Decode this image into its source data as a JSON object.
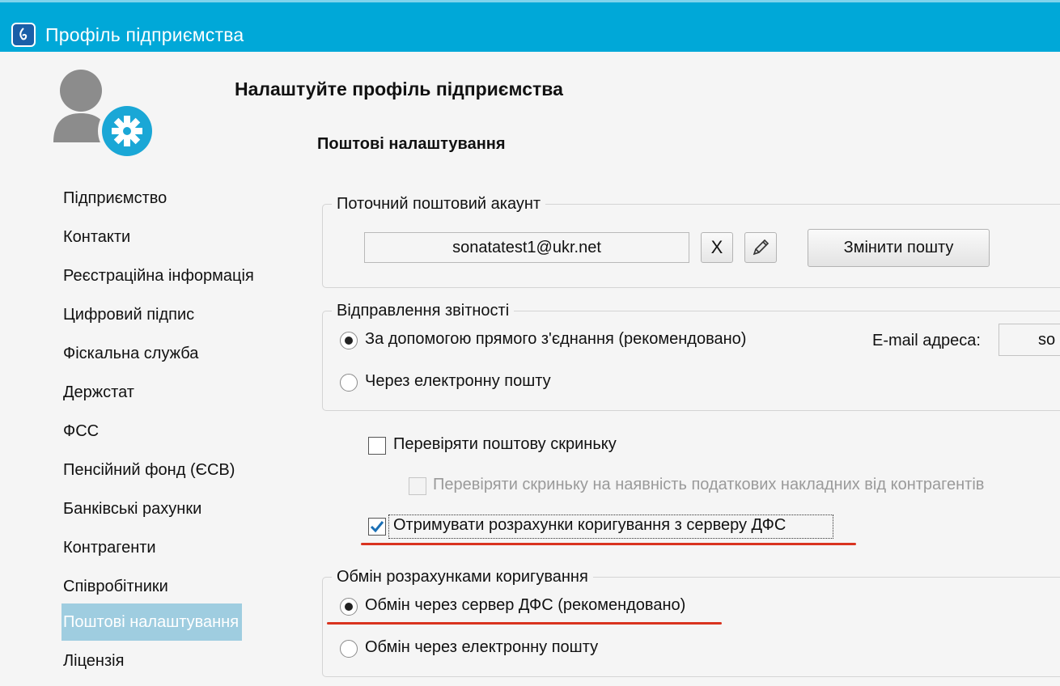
{
  "window": {
    "title": "Профіль підприємства"
  },
  "header": {
    "heading": "Налаштуйте профіль підприємства",
    "section_title": "Поштові налаштування"
  },
  "sidebar": {
    "items": [
      {
        "label": "Підприємство"
      },
      {
        "label": "Контакти"
      },
      {
        "label": "Реєстраційна інформація"
      },
      {
        "label": "Цифровий підпис"
      },
      {
        "label": "Фіскальна служба"
      },
      {
        "label": "Держстат"
      },
      {
        "label": "ФСС"
      },
      {
        "label": "Пенсійний фонд (ЄСВ)"
      },
      {
        "label": "Банківські рахунки"
      },
      {
        "label": "Контрагенти"
      },
      {
        "label": "Співробітники"
      },
      {
        "label": "Поштові налаштування",
        "active": true
      },
      {
        "label": "Ліцензія"
      }
    ]
  },
  "mail_account": {
    "legend": "Поточний поштовий акаунт",
    "email_value": "sonatatest1@ukr.net",
    "clear_label": "X",
    "change_button_label": "Змінити пошту"
  },
  "reporting": {
    "legend": "Відправлення звітності",
    "option_direct": "За допомогою прямого з'єднання (рекомендовано)",
    "option_email": "Через електронну пошту",
    "email_address_label": "E-mail адреса:",
    "email_address_value": "so",
    "selected": "direct"
  },
  "checkboxes": {
    "check_mailbox": {
      "label": "Перевіряти поштову скриньку",
      "checked": false
    },
    "check_tax_invoices": {
      "label": "Перевіряти скриньку на наявність податкових накладних від контрагентів",
      "checked": false,
      "disabled": true
    },
    "receive_corrections": {
      "label": "Отримувати розрахунки коригування з серверу ДФС",
      "checked": true
    }
  },
  "corrections_exchange": {
    "legend": "Обмін розрахунками коригування",
    "option_server": "Обмін через сервер ДФС (рекомендовано)",
    "option_email": "Обмін через електронну пошту",
    "selected": "server"
  },
  "colors": {
    "titlebar": "#00a8d8",
    "active_nav": "#9fcde0",
    "underline": "#d9331f"
  }
}
